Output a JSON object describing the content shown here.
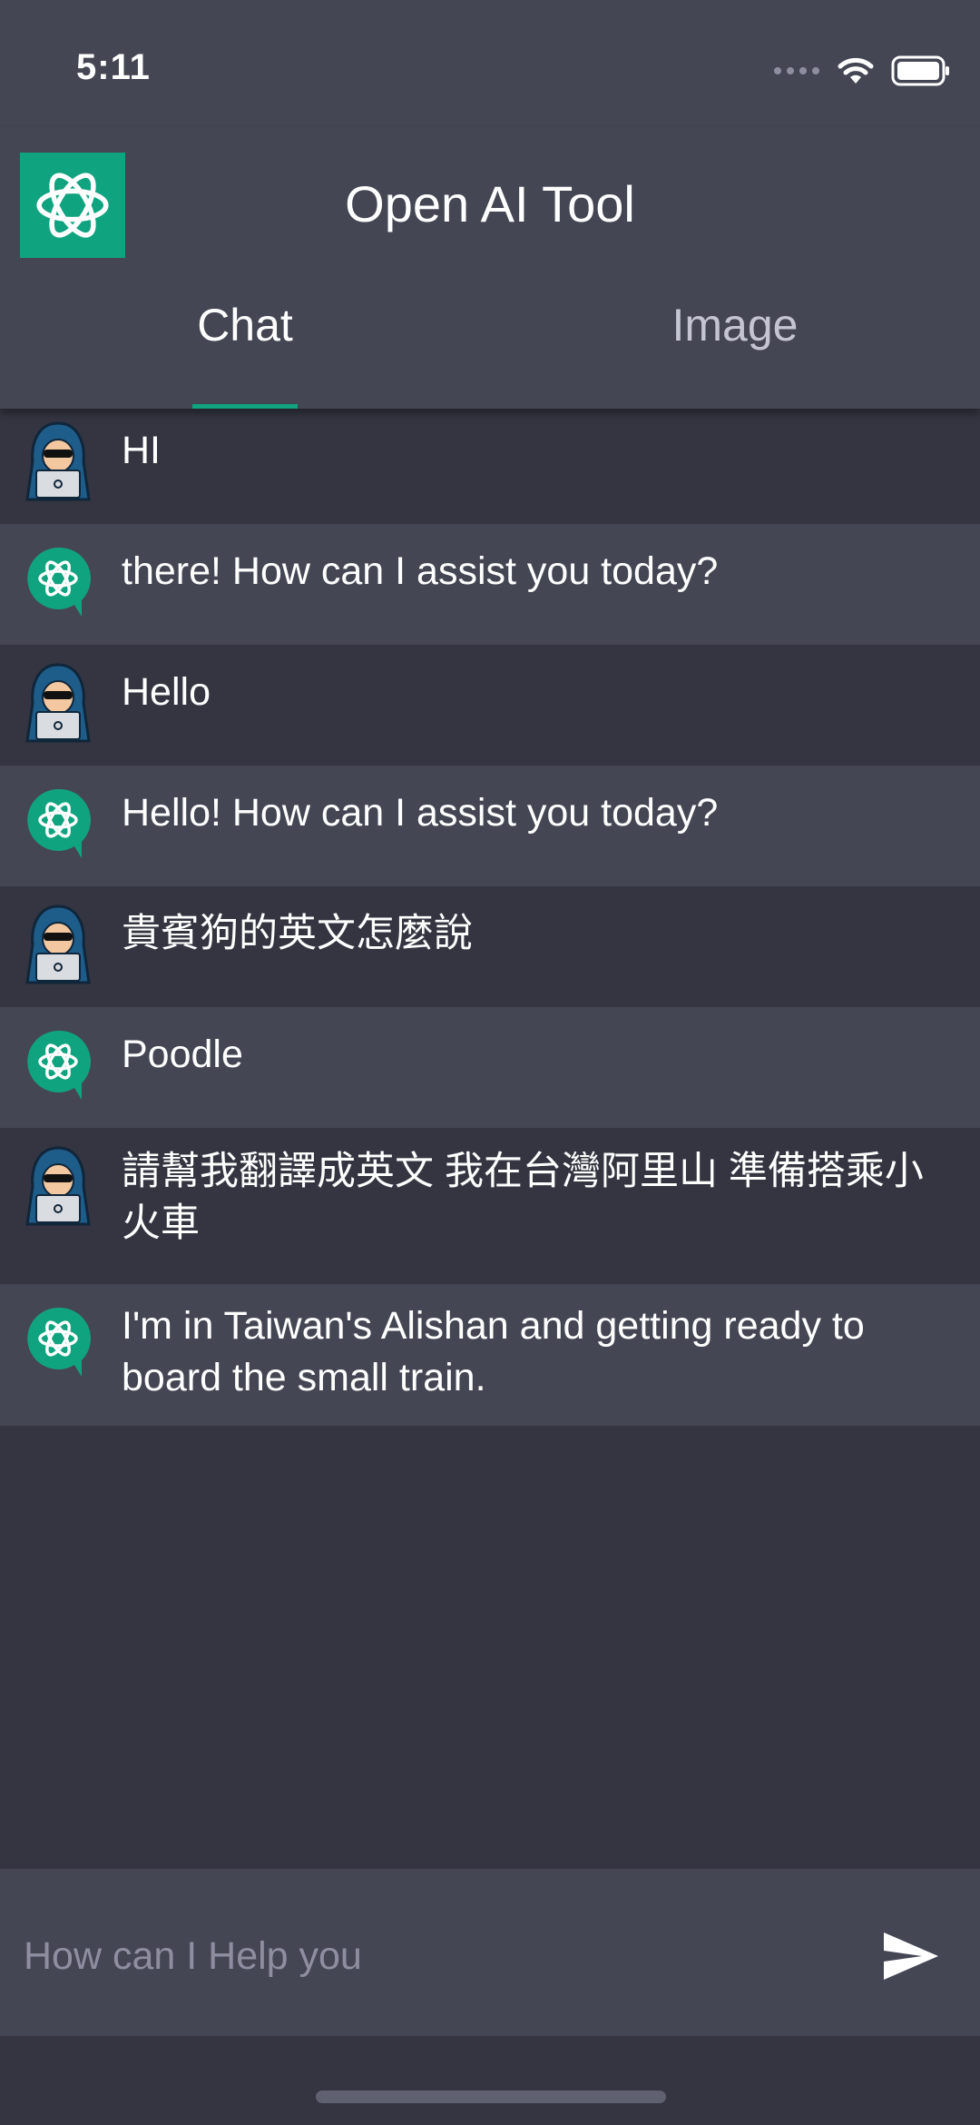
{
  "status_bar": {
    "time": "5:11"
  },
  "header": {
    "title": "Open AI Tool"
  },
  "tabs": [
    {
      "label": "Chat",
      "active": true
    },
    {
      "label": "Image",
      "active": false
    }
  ],
  "messages": [
    {
      "role": "user",
      "text": "HI"
    },
    {
      "role": "bot",
      "text": "there! How can I assist you today?"
    },
    {
      "role": "user",
      "text": "Hello"
    },
    {
      "role": "bot",
      "text": "Hello! How can I assist you today?"
    },
    {
      "role": "user",
      "text": "貴賓狗的英文怎麼說"
    },
    {
      "role": "bot",
      "text": "Poodle"
    },
    {
      "role": "user",
      "text": "請幫我翻譯成英文 我在台灣阿里山 準備搭乘小火車"
    },
    {
      "role": "bot",
      "text": "I'm in Taiwan's Alishan and getting ready to board the small train."
    }
  ],
  "input": {
    "placeholder": "How can I Help you",
    "value": ""
  },
  "colors": {
    "accent": "#10a37f",
    "background": "#343541",
    "panel": "#444654"
  }
}
